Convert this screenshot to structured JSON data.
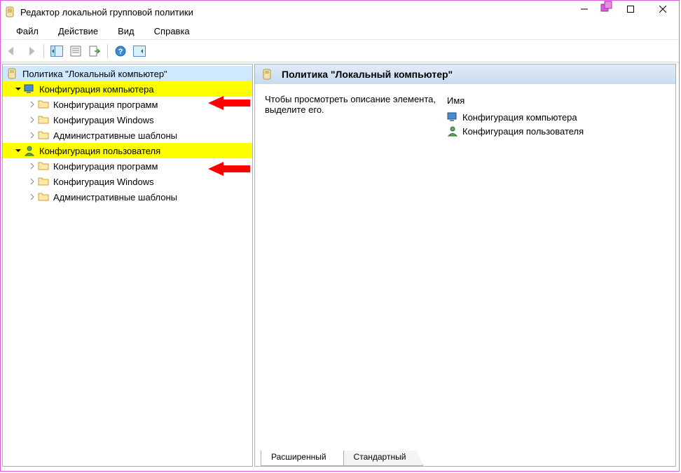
{
  "window": {
    "title": "Редактор локальной групповой политики"
  },
  "menu": {
    "file": "Файл",
    "action": "Действие",
    "view": "Вид",
    "help": "Справка"
  },
  "tree": {
    "root": "Политика \"Локальный компьютер\"",
    "computer": "Конфигурация компьютера",
    "software1": "Конфигурация программ",
    "windows1": "Конфигурация Windows",
    "admin1": "Административные шаблоны",
    "user": "Конфигурация пользователя",
    "software2": "Конфигурация программ",
    "windows2": "Конфигурация Windows",
    "admin2": "Административные шаблоны"
  },
  "content": {
    "header": "Политика \"Локальный компьютер\"",
    "description": "Чтобы просмотреть описание элемента, выделите его.",
    "column_name": "Имя",
    "item_computer": "Конфигурация компьютера",
    "item_user": "Конфигурация пользователя"
  },
  "tabs": {
    "extended": "Расширенный",
    "standard": "Стандартный"
  }
}
